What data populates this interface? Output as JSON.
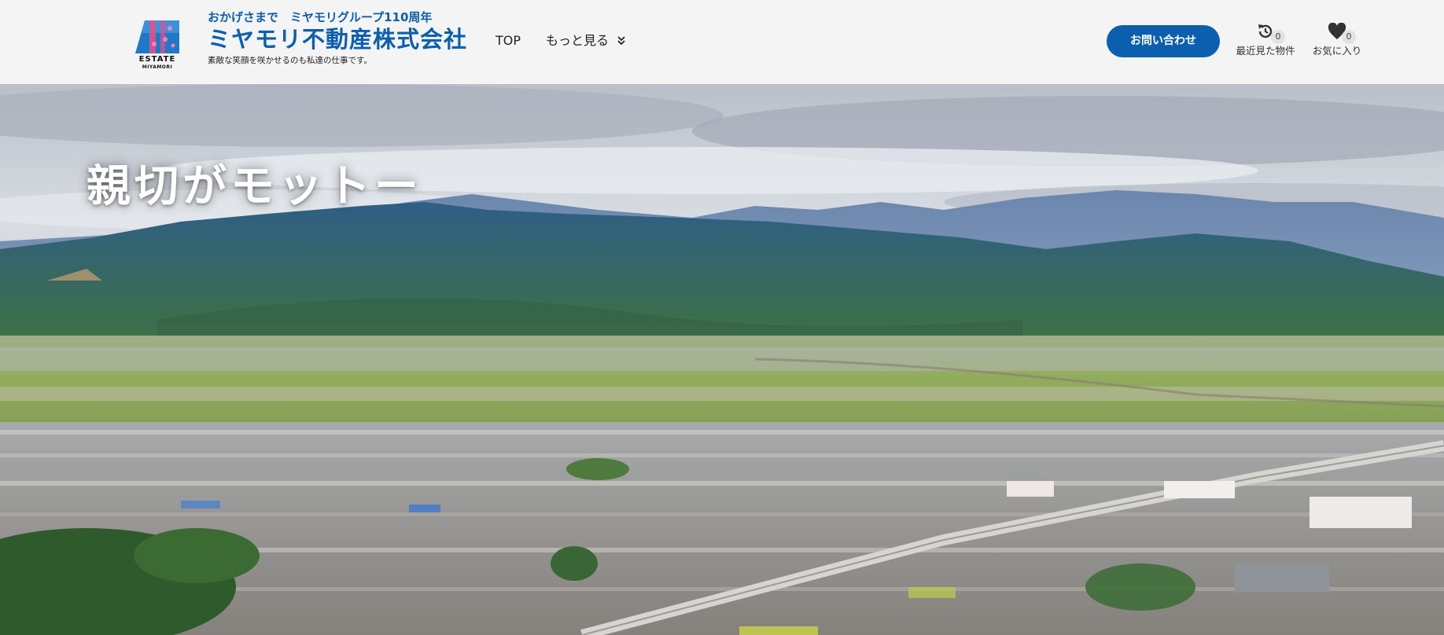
{
  "header": {
    "logo": {
      "mark_text": "ESTATE",
      "mark_subtext": "MIYAMORI",
      "anniversary": "おかげさまで　ミヤモリグループ110周年",
      "company_name": "ミヤモリ不動産株式会社",
      "tagline": "素敵な笑顔を咲かせるのも私達の仕事です。"
    },
    "nav": [
      {
        "label": "TOP"
      },
      {
        "label": "もっと見る"
      }
    ],
    "contact_button": "お問い合わせ",
    "recently_viewed": {
      "label": "最近見た物件",
      "count": "0",
      "icon": "history-icon"
    },
    "favorites": {
      "label": "お気に入り",
      "count": "0",
      "icon": "heart-icon"
    }
  },
  "hero": {
    "heading": "親切がモットー"
  },
  "colors": {
    "brand_blue": "#0b5fae",
    "header_bg": "#f4f4f4",
    "badge_bg": "#e2e2e2"
  }
}
